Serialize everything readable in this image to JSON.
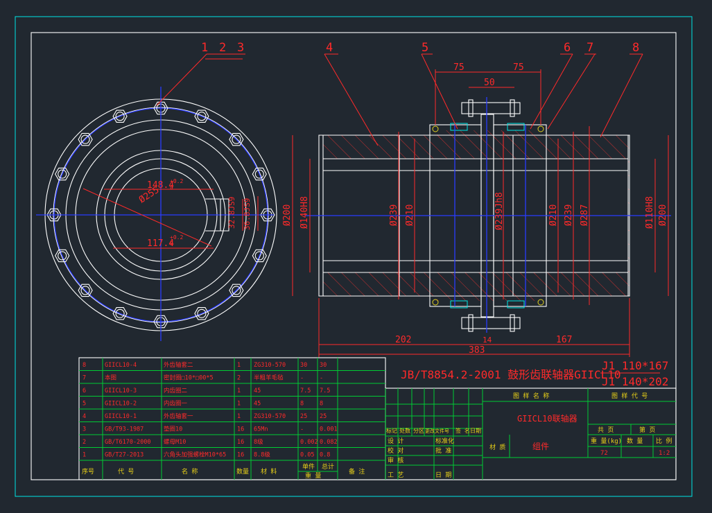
{
  "balloons": [
    "1",
    "2",
    "3",
    "4",
    "5",
    "6",
    "7",
    "8"
  ],
  "left_view": {
    "dim_keyway_width": "148.4",
    "dim_keyway_width_tol": "+0.2",
    "dim_keyway_width_tol0": "0",
    "dim_key_depth": "117.4",
    "dim_key_depth_tol": "+0.2",
    "dim_key_depth_tol0": "0",
    "dim_bolt_circle": "Ø255",
    "dim_keyway_a": "32.8JS9",
    "dim_keyway_b": "36.8JS9"
  },
  "main_view": {
    "dim_75_left": "75",
    "dim_75_right": "75",
    "dim_50": "50",
    "dim_left_outer": "Ø200",
    "dim_left_bore": "Ø140H8",
    "dim_239_l": "Ø239",
    "dim_210_l": "Ø210",
    "dim_center": "Ø239Jh8",
    "dim_210_r": "Ø210",
    "dim_239_r": "Ø239",
    "dim_287": "Ø287",
    "dim_right_bore": "Ø110H8",
    "dim_right_outer": "Ø200",
    "dim_202": "202",
    "dim_14": "14",
    "dim_167": "167",
    "dim_383": "383"
  },
  "title": {
    "standard": "JB/T8854.2-2001 鼓形齿联轴器GIICL10",
    "spec_top": "J1 110*167",
    "spec_bottom": "J1 140*202"
  },
  "bom": {
    "rows": [
      {
        "no": "8",
        "code": "GIICL10-4",
        "name": "外齿轴套二",
        "qty": "1",
        "material": "ZG310-570",
        "unit": "30",
        "total": "30",
        "note": ""
      },
      {
        "no": "7",
        "code": "本图",
        "name": "密封圈□10*□00*5",
        "qty": "2",
        "material": "半粗羊毛毡",
        "unit": "-",
        "total": "-",
        "note": ""
      },
      {
        "no": "6",
        "code": "GIICL10-3",
        "name": "内齿圈二",
        "qty": "1",
        "material": "45",
        "unit": "7.5",
        "total": "7.5",
        "note": ""
      },
      {
        "no": "5",
        "code": "GIICL10-2",
        "name": "内齿圈一",
        "qty": "1",
        "material": "45",
        "unit": "8",
        "total": "8",
        "note": ""
      },
      {
        "no": "4",
        "code": "GIICL10-1",
        "name": "外齿轴套一",
        "qty": "1",
        "material": "ZG310-570",
        "unit": "25",
        "total": "25",
        "note": ""
      },
      {
        "no": "3",
        "code": "GB/T93-1987",
        "name": "垫圈10",
        "qty": "16",
        "material": "65Mn",
        "unit": "-",
        "total": "0.001",
        "note": ""
      },
      {
        "no": "2",
        "code": "GB/T6170-2000",
        "name": "螺母M10",
        "qty": "16",
        "material": "8级",
        "unit": "0.002",
        "total": "0.082",
        "note": ""
      },
      {
        "no": "1",
        "code": "GB/T27-2013",
        "name": "六角头加强螺栓M10*65",
        "qty": "16",
        "material": "8.8级",
        "unit": "0.05",
        "total": "0.8",
        "note": ""
      }
    ],
    "headers": {
      "no": "序号",
      "code": "代  号",
      "name": "名   称",
      "qty": "数量",
      "material": "材  料",
      "unit": "单件",
      "total": "总计",
      "weight": "重   量",
      "note": "备  注"
    }
  },
  "titleblock": {
    "drawing_name_label": "图 样 名 称",
    "drawing_code_label": "图 样 代 号",
    "drawing_name": "GIICL10联轴器",
    "rev_labels": [
      "标记",
      "处数",
      "分区",
      "更改文件号",
      "签 名",
      "日期"
    ],
    "role_design": "设 计",
    "role_standard": "标准化",
    "role_check": "校 对",
    "role_approve": "批 准",
    "role_review": "审 核",
    "role_process": "工 艺",
    "role_date": "日 期",
    "material_label": "材 质",
    "material_value": "组件",
    "sheets_label": "共   页",
    "sheet_label": "第   页",
    "weight_label": "重 量(kg)",
    "count_label": "数  量",
    "scale_label": "比  例",
    "weight_value": "72",
    "scale_value": "1:2"
  }
}
